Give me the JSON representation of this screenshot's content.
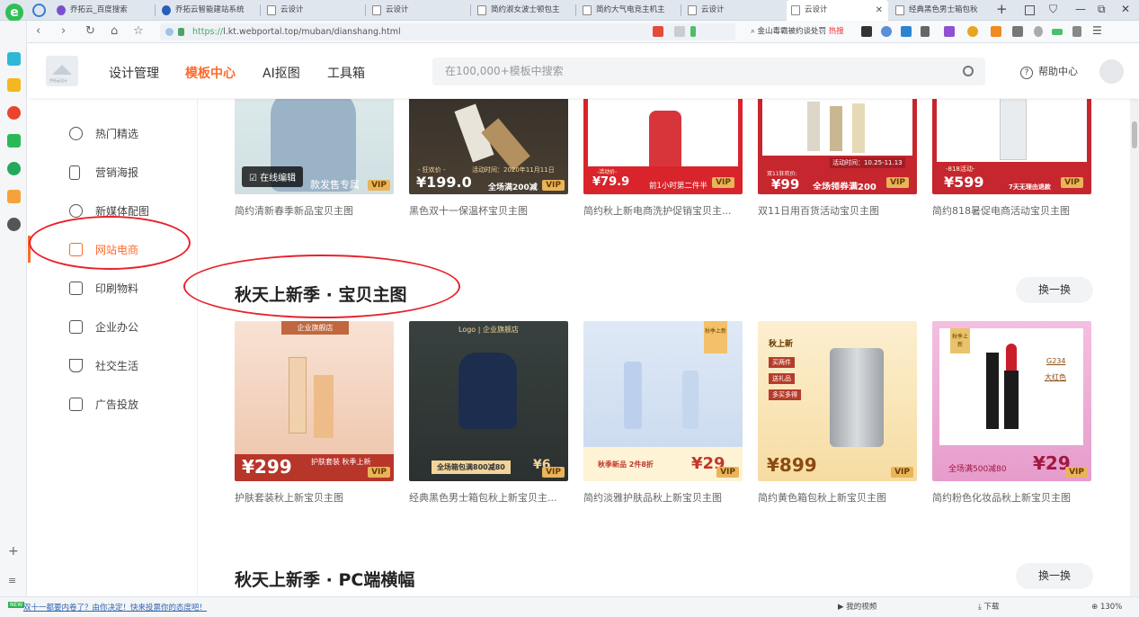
{
  "browser": {
    "tabs": [
      {
        "label": "乔拓云_百度搜索"
      },
      {
        "label": "乔拓云智能建站系统"
      },
      {
        "label": "云设计"
      },
      {
        "label": "云设计"
      },
      {
        "label": "简约淑女波士顿包主"
      },
      {
        "label": "简约大气电竞主机主"
      },
      {
        "label": "云设计"
      },
      {
        "label": "云设计"
      },
      {
        "label": "经典黑色男士箱包秋"
      }
    ],
    "url_scheme": "https://",
    "url_rest": "l.kt.webportal.top/muban/dianshang.html",
    "search_text": "金山毒霸被约谈处罚",
    "search_hot": "热搜",
    "status_news": "双十一都要内卷了？由你决定！快来投票你的态度吧！",
    "status_new_tag": "NEW",
    "status_right": "我的视频",
    "status_download": "下载",
    "zoom": "130%"
  },
  "site": {
    "nav": [
      "设计管理",
      "模板中心",
      "AI抠图",
      "工具箱"
    ],
    "search_placeholder": "在100,000+模板中搜索",
    "help_label": "帮助中心",
    "logo_text": "乔拓云设计"
  },
  "categories": [
    "热门精选",
    "营销海报",
    "新媒体配图",
    "网站电商",
    "印刷物料",
    "企业办公",
    "社交生活",
    "广告投放"
  ],
  "top_row": [
    {
      "title": "简约清新春季新品宝贝主图",
      "overlay": "在线编辑",
      "banner": "款发售专属"
    },
    {
      "title": "黑色双十一保温杯宝贝主图",
      "price": "¥199.0",
      "tag": "- 狂欢价 -",
      "event": "活动时间：2020年11月11日",
      "promo": "全场满200减"
    },
    {
      "title": "简约秋上新电商洗护促销宝贝主...",
      "price": "¥79.9",
      "tag": "-活动价-",
      "promo": "前1小时第二件半"
    },
    {
      "title": "双11日用百货活动宝贝主图",
      "price": "¥99",
      "tag": "双11狂欢价:",
      "event": "活动时间：10.25-11.13",
      "promo": "全场领券满200"
    },
    {
      "title": "简约818暑促电商活动宝贝主图",
      "price": "¥599",
      "tag": "-818活动-",
      "promo": "7天无理由退款"
    }
  ],
  "section1": {
    "title": "秋天上新季 · 宝贝主图",
    "swap_label": "换一换",
    "cards": [
      {
        "title": "护肤套装秋上新宝贝主图",
        "price": "¥299",
        "banner": "企业旗舰店",
        "promo": "护肤套装 秋季上新"
      },
      {
        "title": "经典黑色男士箱包秋上新宝贝主...",
        "price": "¥6",
        "banner": "Logo | 企业旗舰店",
        "promo": "全场箱包满800减80"
      },
      {
        "title": "简约淡雅护肤品秋上新宝贝主图",
        "price": "¥29",
        "tag": "秋季上新",
        "promo": "秋季新品 2件8折"
      },
      {
        "title": "简约黄色箱包秋上新宝贝主图",
        "price": "¥899",
        "tag": "秋上新",
        "list": [
          "买两件",
          "送礼品",
          "多买多得"
        ]
      },
      {
        "title": "简约粉色化妆品秋上新宝贝主图",
        "price": "¥29",
        "tag": "秋季上新",
        "code": "G234",
        "color_name": "大红色",
        "promo": "全场满500减80"
      }
    ]
  },
  "section2": {
    "title": "秋天上新季 · PC端横幅",
    "swap_label": "换一换"
  },
  "vip_label": "VIP",
  "colors": {
    "accent": "#ff6a2a",
    "annotation": "#e8222b",
    "vip": "#e9b45a"
  }
}
